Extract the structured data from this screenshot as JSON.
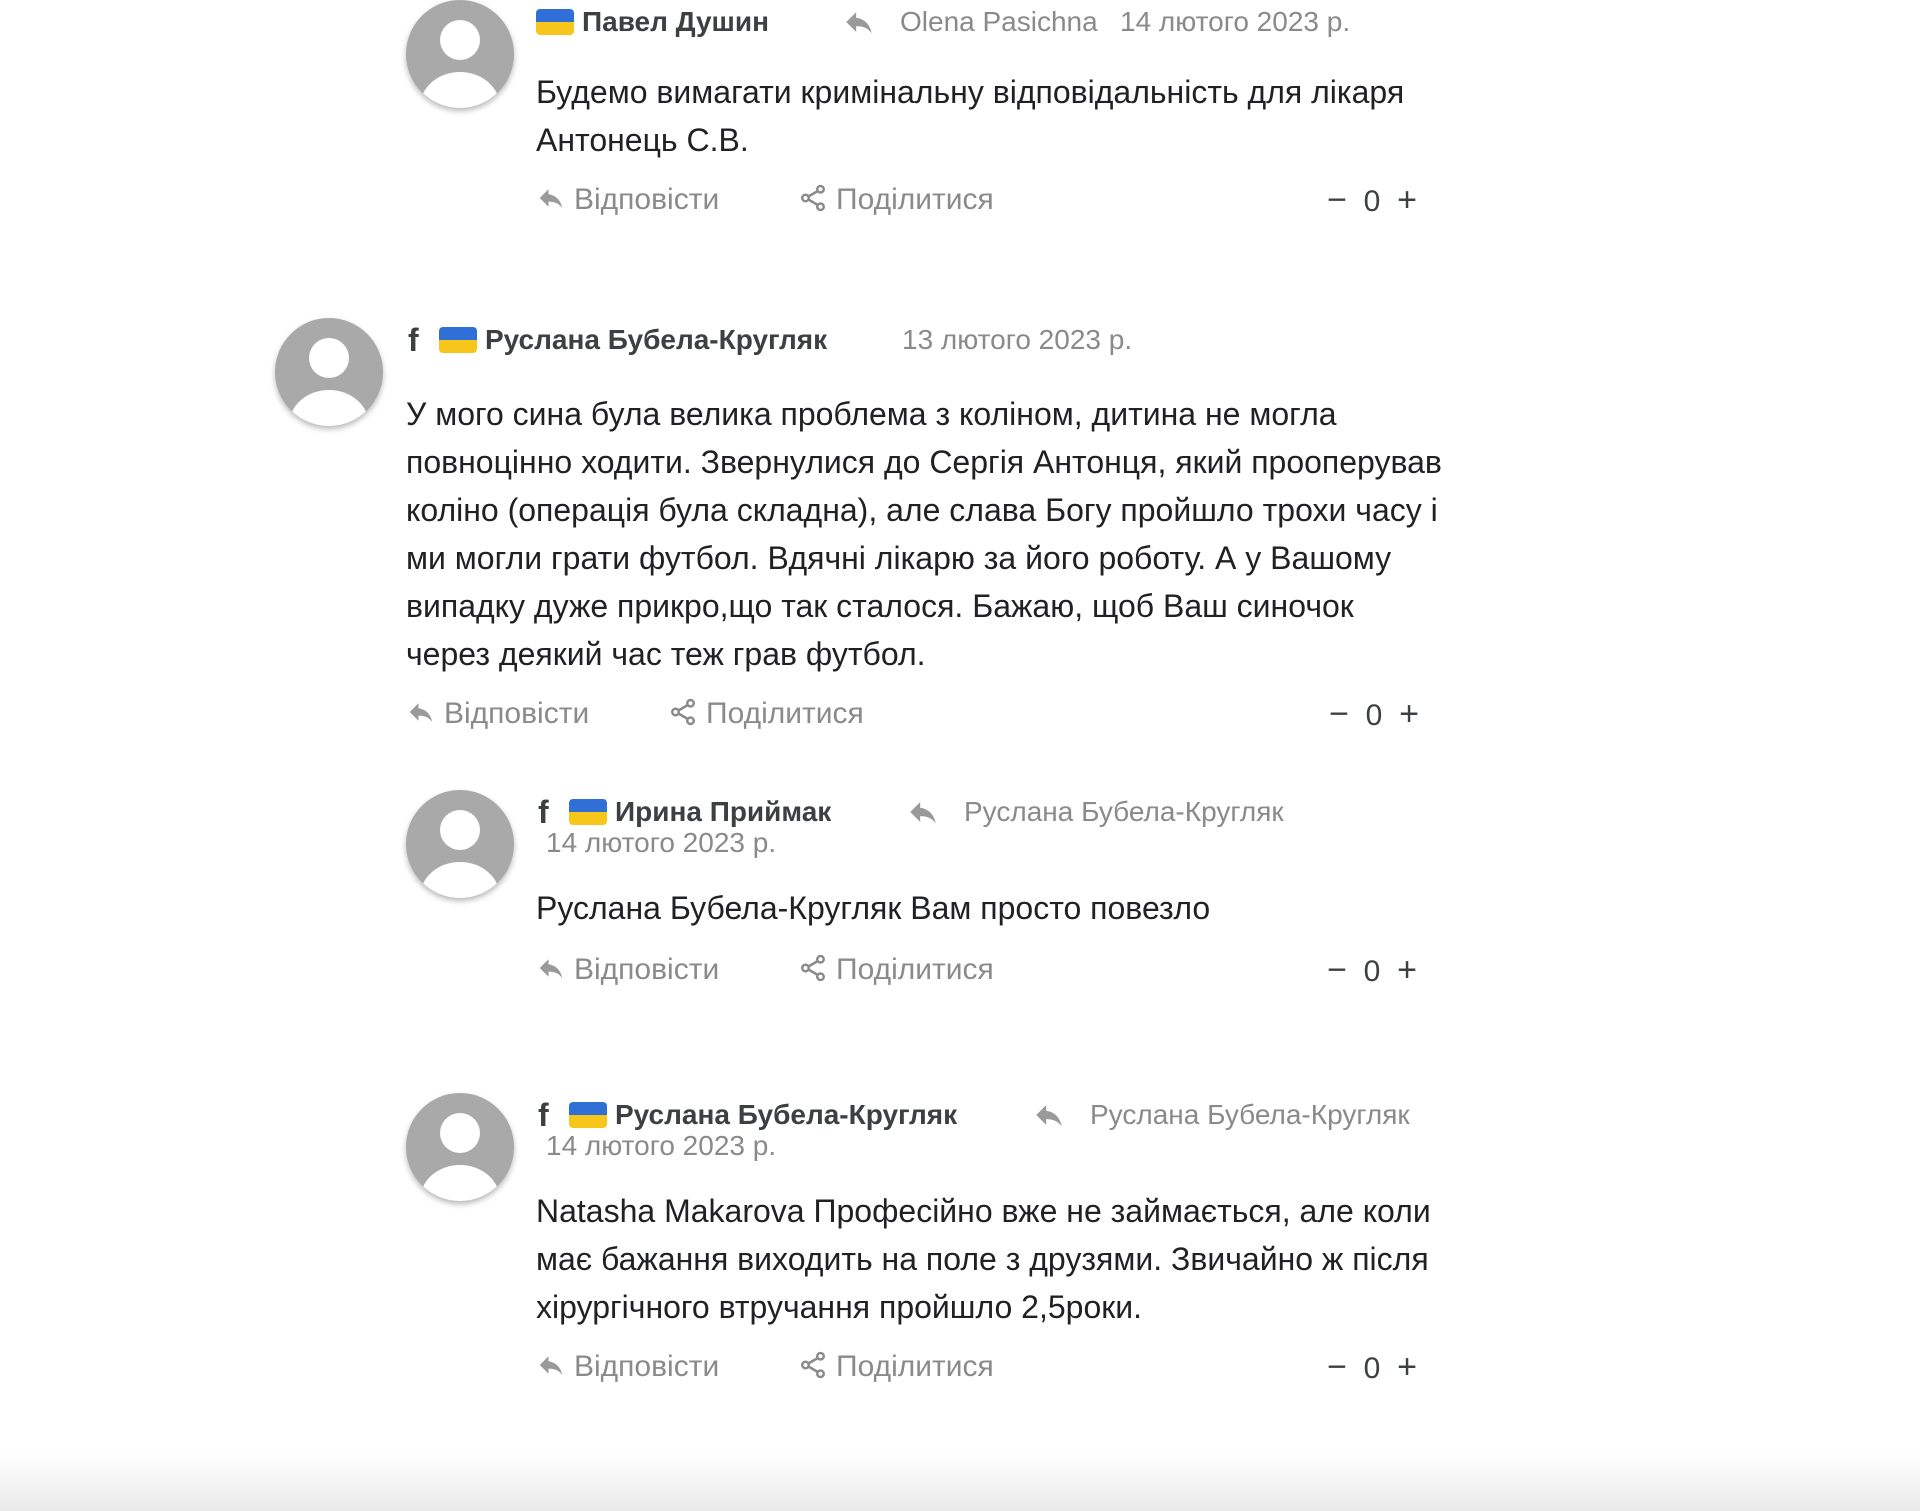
{
  "comments": [
    {
      "author": "Павел Душин",
      "reply_to": "Olena Pasichna",
      "date": "14 лютого 2023 р.",
      "text": "Будемо вимагати кримінальну відповідальність для лікаря Антонець С.В.",
      "reply_label": "Відповісти",
      "share_label": "Поділитися",
      "minus": "−",
      "count": "0",
      "plus": "+"
    },
    {
      "source_icon": "f",
      "author": "Руслана Бубела-Кругляк",
      "date": "13 лютого 2023 р.",
      "text": "У мого сина була велика проблема з коліном, дитина не могла повноцінно ходити. Звернулися до Сергія Антонця, який прооперував коліно (операція була складна), але слава Богу пройшло трохи часу і ми могли грати футбол. Вдячні лікарю за його роботу. А у Вашому випадку дуже прикро,що так сталося. Бажаю, щоб Ваш синочок через деякий час теж грав футбол.",
      "reply_label": "Відповісти",
      "share_label": "Поділитися",
      "minus": "−",
      "count": "0",
      "plus": "+"
    },
    {
      "source_icon": "f",
      "author": "Ирина Приймак",
      "reply_to": "Руслана Бубела-Кругляк",
      "date": "14 лютого 2023 р.",
      "text": "Руслана Бубела-Кругляк Вам просто повезло",
      "reply_label": "Відповісти",
      "share_label": "Поділитися",
      "minus": "−",
      "count": "0",
      "plus": "+"
    },
    {
      "source_icon": "f",
      "author": "Руслана Бубела-Кругляк",
      "reply_to": "Руслана Бубела-Кругляк",
      "date": "14 лютого 2023 р.",
      "text": "Natasha Makarova Професійно вже не займається, але коли має бажання виходить на поле з друзями. Звичайно ж після хірургічного втручання пройшло 2,5роки.",
      "reply_label": "Відповісти",
      "share_label": "Поділитися",
      "minus": "−",
      "count": "0",
      "plus": "+"
    }
  ],
  "icons": {
    "avatar": "default-user-avatar",
    "flag": "ukraine-flag",
    "source": "facebook-icon",
    "reply": "reply-arrow-icon",
    "share": "share-icon"
  },
  "colors": {
    "flag_blue": "#2f6fd6",
    "flag_yellow": "#f7c61a",
    "muted_text": "#8a8a8a",
    "avatar_gray": "#a9a9a9"
  }
}
